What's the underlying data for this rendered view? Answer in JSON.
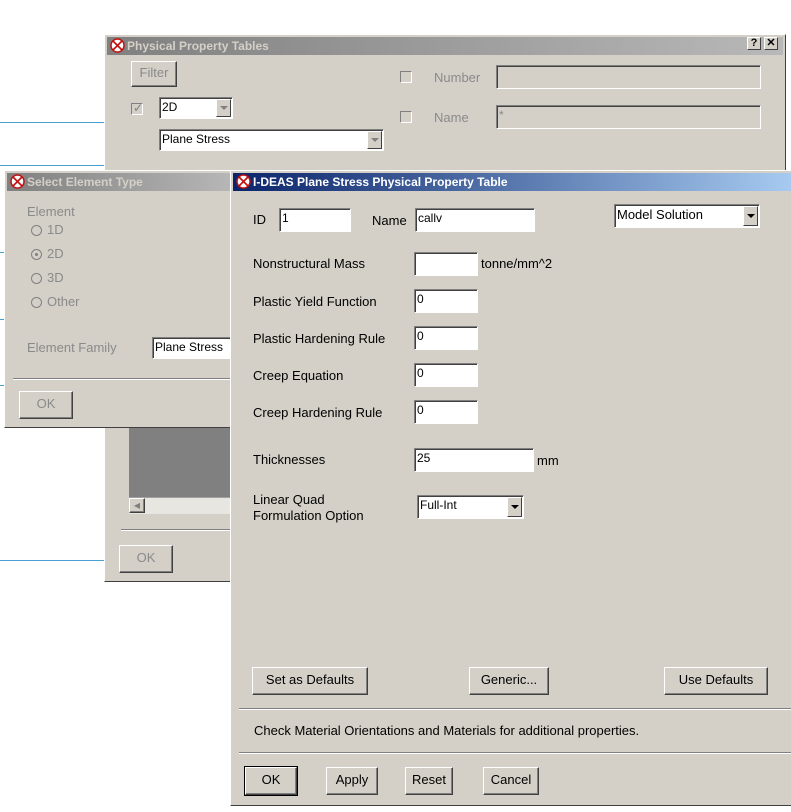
{
  "physical_property_tables": {
    "title": "Physical Property Tables",
    "help_button": "?",
    "close_button": "✕",
    "filter_label": "Filter",
    "dimension_value": "2D",
    "family_value": "Plane Stress",
    "number_label": "Number",
    "name_label": "Name",
    "name_filter_value": "*",
    "ok_label": "OK"
  },
  "select_element_type": {
    "title": "Select Element Type",
    "element_group_label": "Element",
    "options": [
      "1D",
      "2D",
      "3D",
      "Other"
    ],
    "selected_option": "2D",
    "element_family_label": "Element Family",
    "element_family_value": "Plane Stress",
    "ok_label": "OK"
  },
  "property_table": {
    "title": "I-DEAS Plane Stress Physical Property Table",
    "id_label": "ID",
    "id_value": "1",
    "name_label": "Name",
    "name_value": "callv",
    "solution_value": "Model Solution",
    "fields": {
      "nonstructural_mass_label": "Nonstructural Mass",
      "nonstructural_mass_value": "",
      "nonstructural_mass_unit": "tonne/mm^2",
      "plastic_yield_label": "Plastic Yield Function",
      "plastic_yield_value": "0",
      "plastic_hardening_label": "Plastic Hardening Rule",
      "plastic_hardening_value": "0",
      "creep_equation_label": "Creep Equation",
      "creep_equation_value": "0",
      "creep_hardening_label": "Creep Hardening Rule",
      "creep_hardening_value": "0",
      "thicknesses_label": "Thicknesses",
      "thicknesses_value": "25",
      "thicknesses_unit": "mm",
      "linear_quad_label_1": "Linear Quad",
      "linear_quad_label_2": "Formulation Option",
      "linear_quad_value": "Full-Int"
    },
    "set_defaults_label": "Set as Defaults",
    "generic_label": "Generic...",
    "use_defaults_label": "Use Defaults",
    "info_text": "Check Material Orientations and Materials for additional properties.",
    "ok_label": "OK",
    "apply_label": "Apply",
    "reset_label": "Reset",
    "cancel_label": "Cancel"
  },
  "colors": {
    "dialog_face": "#d4d0c8",
    "active_title": "#0a246a",
    "inactive_title": "#808080",
    "guide_line": "#4a9fd0"
  },
  "icons": {
    "app_icon": "ideas-logo-icon"
  }
}
